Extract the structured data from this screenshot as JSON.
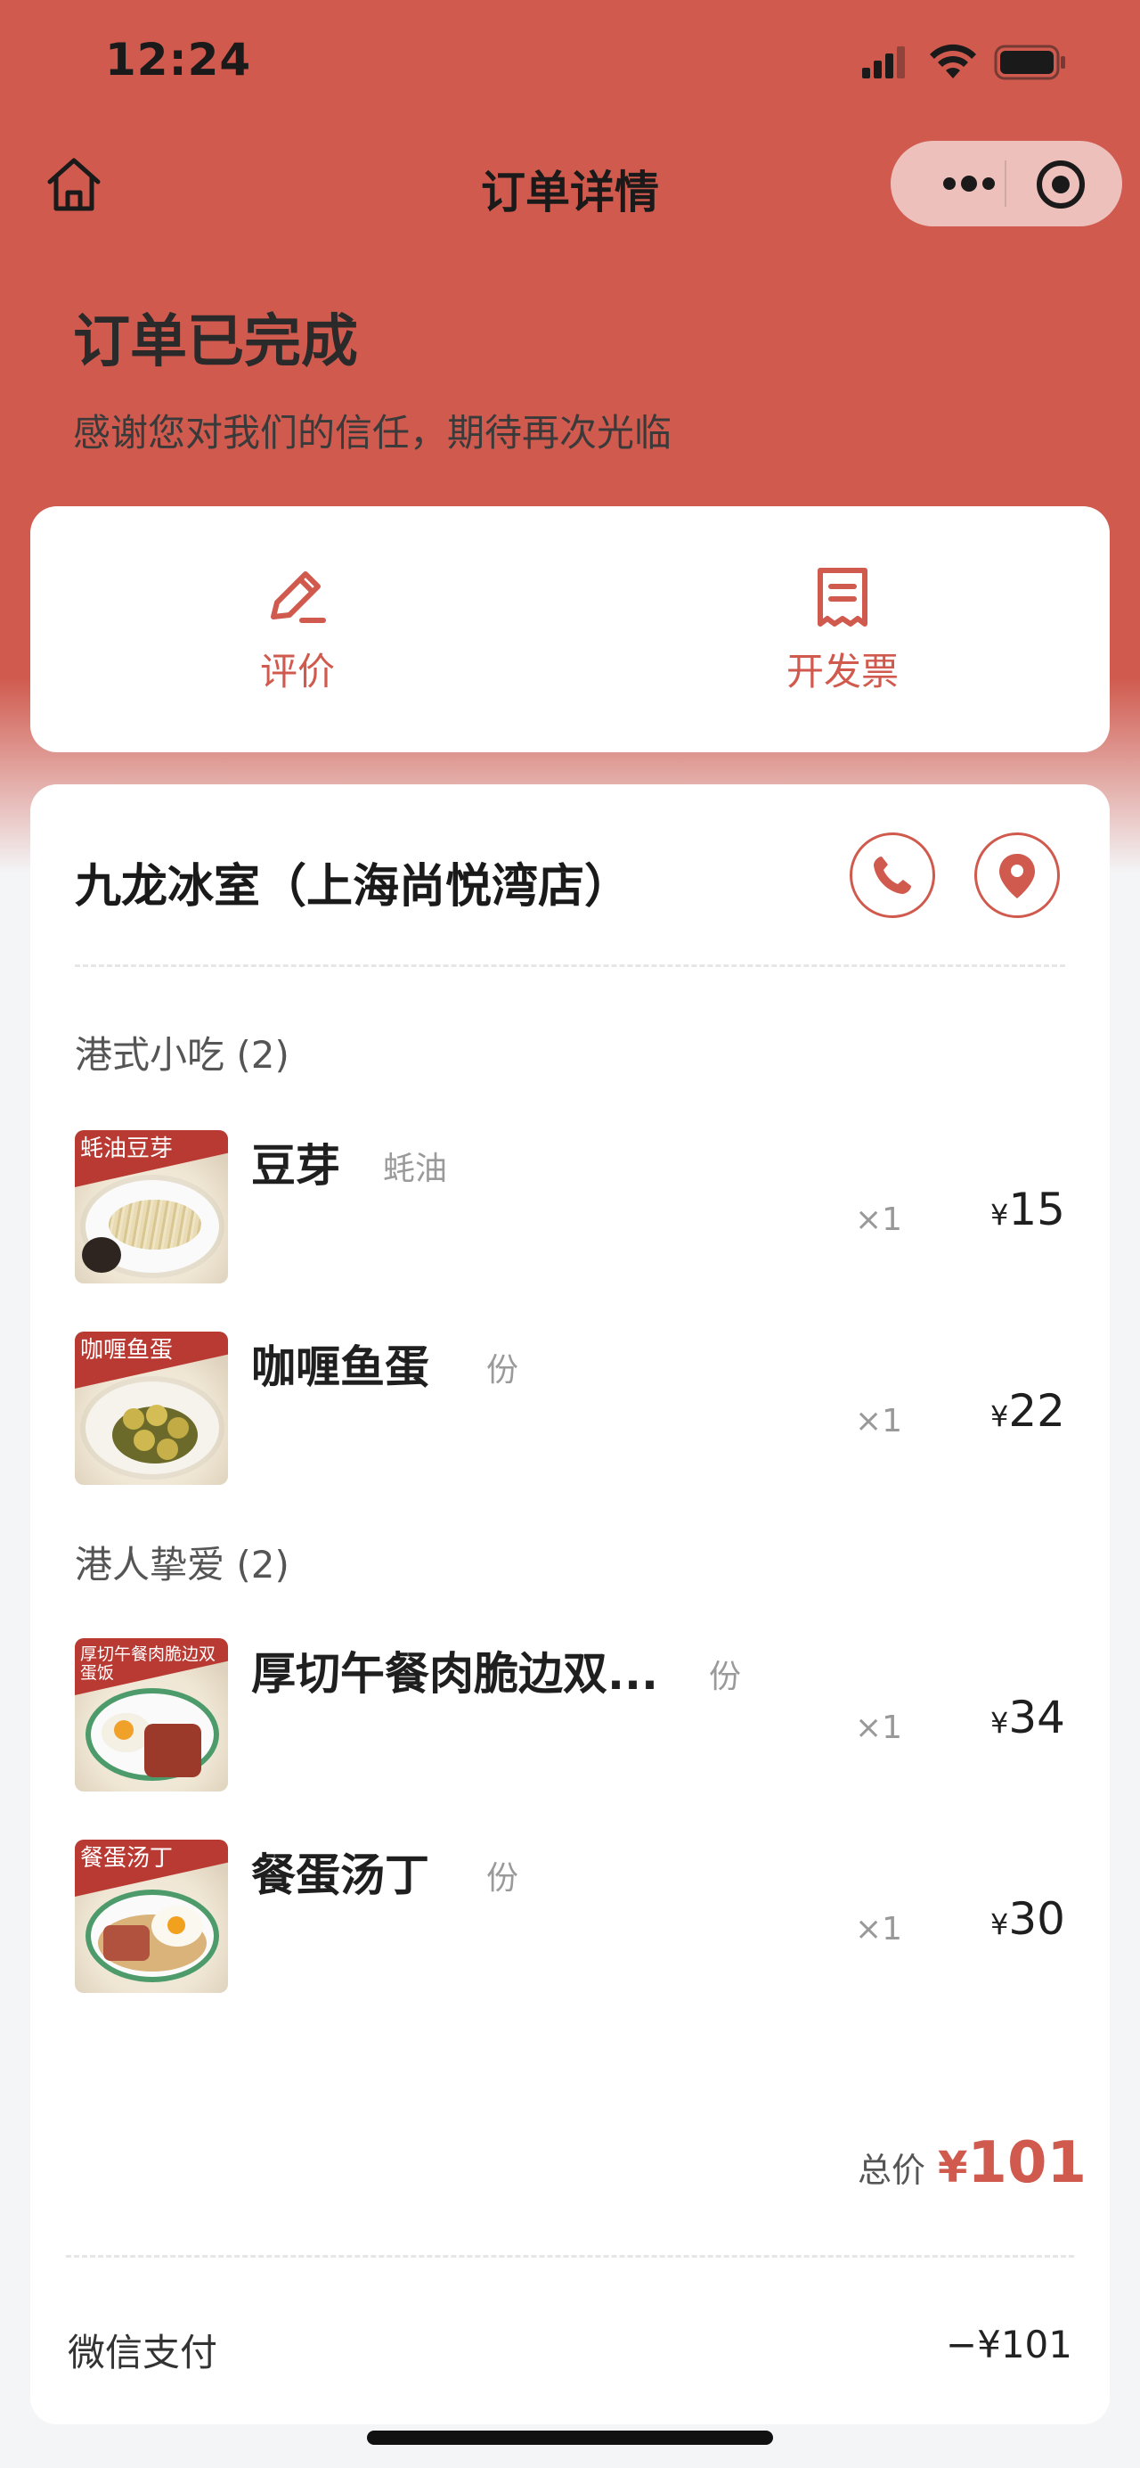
{
  "status_bar": {
    "time": "12:24"
  },
  "nav": {
    "title": "订单详情"
  },
  "order": {
    "status": "订单已完成",
    "subtitle": "感谢您对我们的信任，期待再次光临"
  },
  "actions": [
    {
      "label": "评价",
      "icon": "pencil-icon"
    },
    {
      "label": "开发票",
      "icon": "receipt-icon"
    }
  ],
  "shop": {
    "name": "九龙冰室（上海尚悦湾店）"
  },
  "sections": [
    {
      "title": "港式小吃 (2)",
      "items": [
        {
          "name": "豆芽",
          "spec": "蚝油",
          "thumb_text": "蚝油豆芽",
          "qty": "×1",
          "currency": "¥",
          "price": "15"
        },
        {
          "name": "咖喱鱼蛋",
          "spec": "份",
          "thumb_text": "咖喱鱼蛋",
          "qty": "×1",
          "currency": "¥",
          "price": "22"
        }
      ]
    },
    {
      "title": "港人挚爱 (2)",
      "items": [
        {
          "name": "厚切午餐肉脆边双...",
          "spec": "份",
          "thumb_text": "厚切午餐肉脆边双蛋饭",
          "qty": "×1",
          "currency": "¥",
          "price": "34"
        },
        {
          "name": "餐蛋汤丁",
          "spec": "份",
          "thumb_text": "餐蛋汤丁",
          "qty": "×1",
          "currency": "¥",
          "price": "30"
        }
      ]
    }
  ],
  "summary": {
    "total_label": "总价",
    "total_currency": "¥",
    "total_value": "101",
    "payment_method": "微信支付",
    "payment_amount": "−¥101"
  },
  "colors": {
    "accent": "#d05a4e",
    "background": "#f4f5f7"
  }
}
